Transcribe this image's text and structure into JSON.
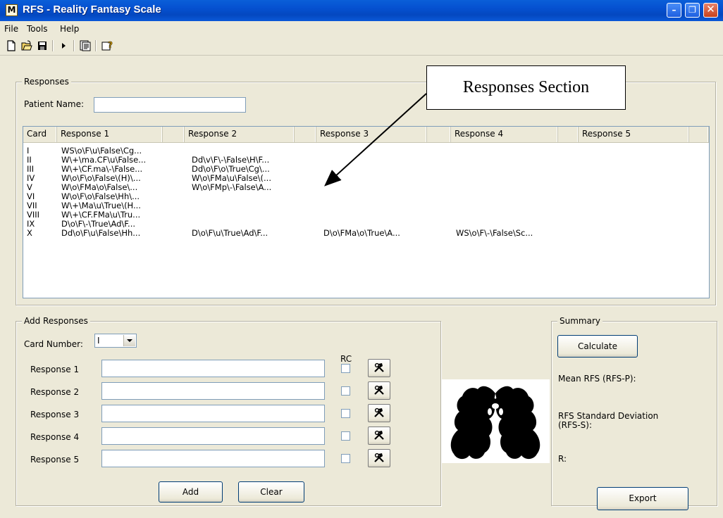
{
  "window": {
    "title": "RFS - Reality Fantasy Scale",
    "icon_glyph": "M",
    "min_glyph": "–",
    "max_glyph": "❐",
    "close_glyph": "✕"
  },
  "menu": {
    "file": "File",
    "tools": "Tools",
    "help": "Help"
  },
  "toolbar": {
    "icons": [
      "new-file-icon",
      "open-folder-icon",
      "save-icon",
      "run-icon",
      "document-icon",
      "help-icon"
    ]
  },
  "responses": {
    "group_title": "Responses",
    "patient_label": "Patient Name:",
    "patient_value": "",
    "columns": [
      "Card",
      "Response 1",
      "",
      "Response 2",
      "",
      "Response 3",
      "",
      "Response 4",
      "",
      "Response 5",
      ""
    ],
    "rows": [
      [
        "I",
        "WS\\o\\F\\u\\False\\Cg...",
        "",
        "",
        "",
        ""
      ],
      [
        "II",
        "W\\+\\ma.CF\\u\\False...",
        "Dd\\v\\F\\-\\False\\H\\F...",
        "",
        "",
        ""
      ],
      [
        "III",
        "W\\+\\CF.ma\\-\\False...",
        "Dd\\o\\F\\o\\True\\Cg\\...",
        "",
        "",
        ""
      ],
      [
        "IV",
        "W\\o\\F\\o\\False\\(H)\\...",
        "W\\o\\FMa\\u\\False\\(...",
        "",
        "",
        ""
      ],
      [
        "V",
        "W\\o\\FMa\\o\\False\\...",
        "W\\o\\FMp\\-\\False\\A...",
        "",
        "",
        ""
      ],
      [
        "VI",
        "W\\o\\F\\o\\False\\Hh\\...",
        "",
        "",
        "",
        ""
      ],
      [
        "VII",
        "W\\+\\Ma\\u\\True\\(H...",
        "",
        "",
        "",
        ""
      ],
      [
        "VIII",
        "W\\+\\CF.FMa\\u\\Tru...",
        "",
        "",
        "",
        ""
      ],
      [
        "IX",
        "D\\o\\F\\-\\True\\Ad\\F...",
        "",
        "",
        "",
        ""
      ],
      [
        "X",
        "Dd\\o\\F\\u\\False\\Hh...",
        "D\\o\\F\\u\\True\\Ad\\F...",
        "D\\o\\FMa\\o\\True\\A...",
        "WS\\o\\F\\-\\False\\Sc...",
        ""
      ]
    ]
  },
  "annotation": {
    "text": "Responses Section"
  },
  "add_responses": {
    "group_title": "Add Responses",
    "card_label": "Card Number:",
    "card_value": "I",
    "rc_label": "RC",
    "labels": [
      "Response 1",
      "Response 2",
      "Response 3",
      "Response 4",
      "Response 5"
    ],
    "values": [
      "",
      "",
      "",
      "",
      ""
    ],
    "add_button": "Add",
    "clear_button": "Clear"
  },
  "summary": {
    "group_title": "Summary",
    "calculate_button": "Calculate",
    "mean_label": "Mean RFS (RFS-P):",
    "sd_label_line1": "RFS Standard Deviation",
    "sd_label_line2": "(RFS-S):",
    "r_label": "R:",
    "export_button": "Export"
  }
}
